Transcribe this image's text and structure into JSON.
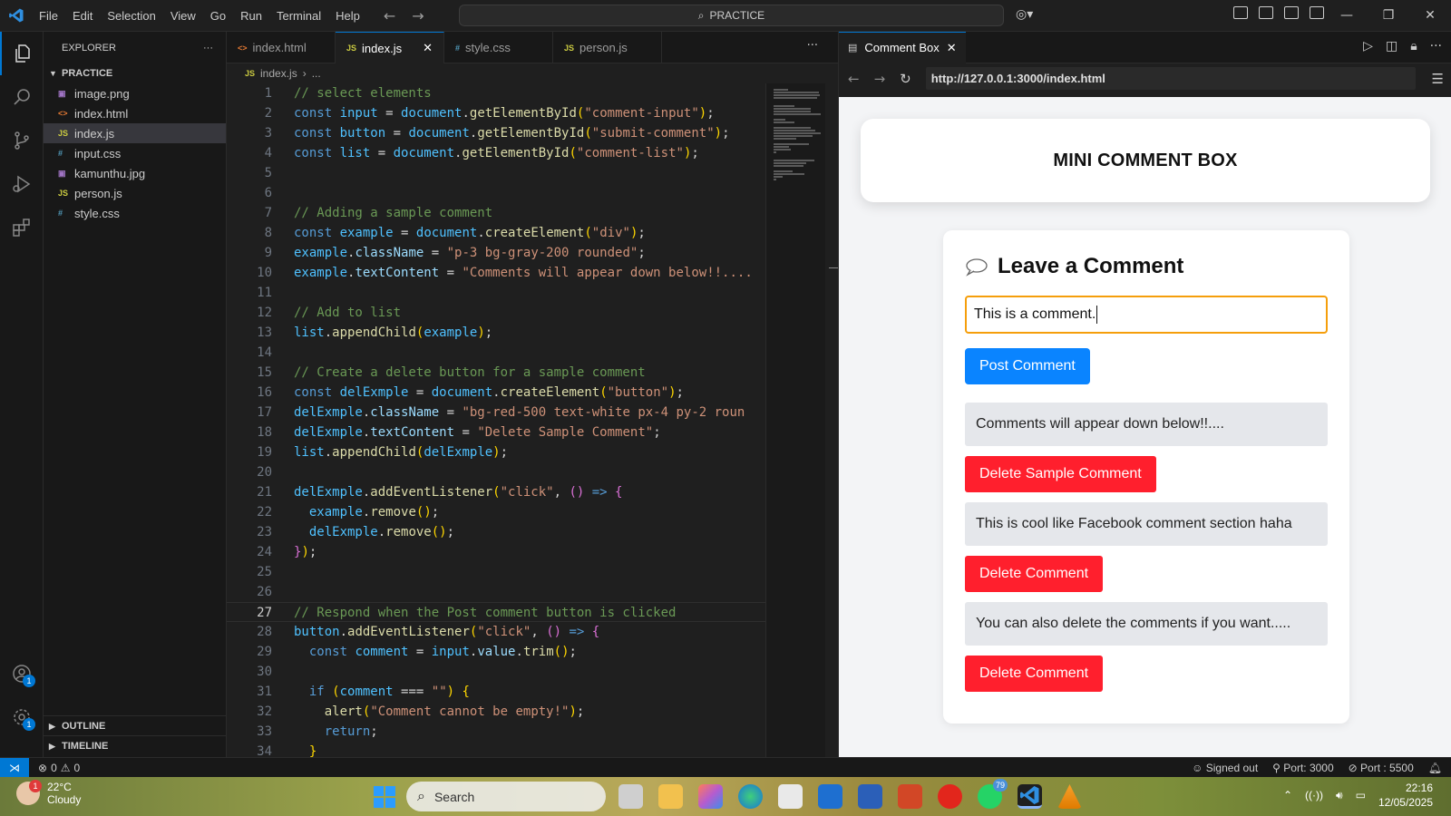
{
  "titlebar": {
    "menu": [
      "File",
      "Edit",
      "Selection",
      "View",
      "Go",
      "Run",
      "Terminal",
      "Help"
    ],
    "search": "PRACTICE",
    "window_controls": [
      "—",
      "❐",
      "✕"
    ]
  },
  "activity_bar": {
    "items": [
      "explorer-icon",
      "search-icon",
      "source-control-icon",
      "run-debug-icon",
      "extensions-icon"
    ],
    "accounts_badge": "1",
    "settings_badge": "1"
  },
  "explorer": {
    "title": "EXPLORER",
    "more": "···",
    "folder": "PRACTICE",
    "files": [
      {
        "name": "image.png",
        "icon": "▣",
        "color": "#a074c4"
      },
      {
        "name": "index.html",
        "icon": "<>",
        "color": "#e37933"
      },
      {
        "name": "index.js",
        "icon": "JS",
        "color": "#cbcb41"
      },
      {
        "name": "input.css",
        "icon": "#",
        "color": "#519aba"
      },
      {
        "name": "kamunthu.jpg",
        "icon": "▣",
        "color": "#a074c4"
      },
      {
        "name": "person.js",
        "icon": "JS",
        "color": "#cbcb41"
      },
      {
        "name": "style.css",
        "icon": "#",
        "color": "#519aba"
      }
    ],
    "outline": "OUTLINE",
    "timeline": "TIMELINE"
  },
  "editor": {
    "tabs": [
      {
        "label": "index.html",
        "icon": "<>",
        "color": "#e37933",
        "active": false
      },
      {
        "label": "index.js",
        "icon": "JS",
        "color": "#cbcb41",
        "active": true
      },
      {
        "label": "style.css",
        "icon": "#",
        "color": "#519aba",
        "active": false
      },
      {
        "label": "person.js",
        "icon": "JS",
        "color": "#cbcb41",
        "active": false
      }
    ],
    "breadcrumb": {
      "file": "index.js",
      "rest": "..."
    },
    "current_line": 27
  },
  "browser": {
    "tab_title": "Comment Box",
    "url": "http://127.0.0.1:3000/index.html",
    "page": {
      "header": "MINI COMMENT BOX",
      "heading": "Leave a Comment",
      "input_value": "This is a comment.",
      "post_button": "Post Comment",
      "comments": [
        {
          "text": "Comments will appear down below!!....",
          "button": "Delete Sample Comment"
        },
        {
          "text": "This is cool like Facebook comment section haha",
          "button": "Delete Comment"
        },
        {
          "text": "You can also delete the comments if you want.....",
          "button": "Delete Comment"
        }
      ]
    }
  },
  "statusbar": {
    "errors": "0",
    "warnings": "0",
    "signed_out": "Signed out",
    "port1": "Port: 3000",
    "port2": "Port : 5500"
  },
  "taskbar": {
    "temperature": "22°C",
    "condition": "Cloudy",
    "weather_badge": "1",
    "search": "Search",
    "whatsapp_badge": "79",
    "time": "22:16",
    "date": "12/05/2025"
  },
  "colors": {
    "accent": "#0078d4",
    "post_button": "#0a84ff",
    "delete_button": "#ff1f2d",
    "input_border": "#f59e0b"
  }
}
